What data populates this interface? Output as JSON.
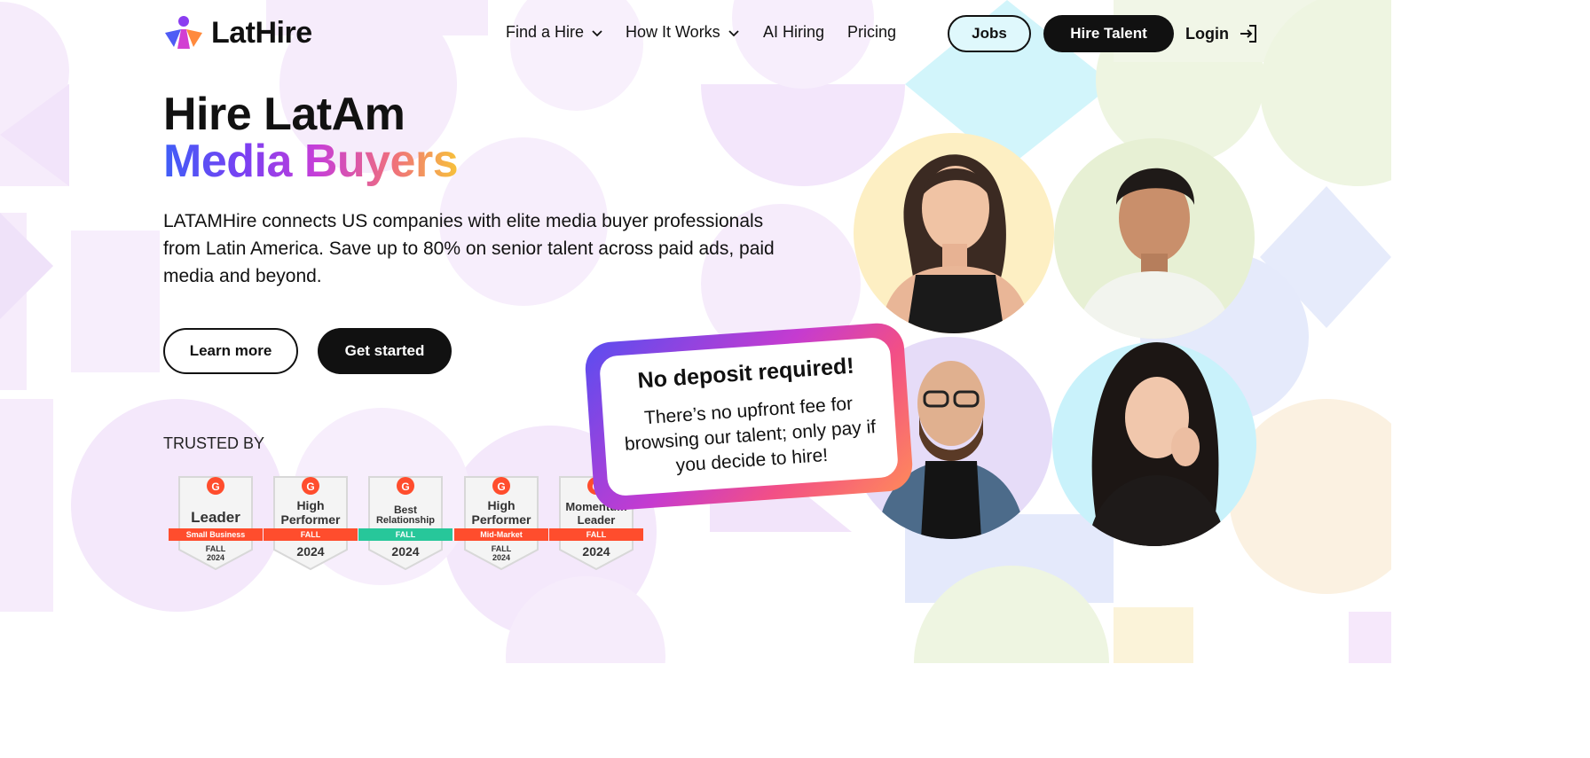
{
  "nav": {
    "logo_text": "LatHire",
    "items": [
      {
        "label": "Find a Hire"
      },
      {
        "label": "How It Works"
      },
      {
        "label": "AI Hiring"
      },
      {
        "label": "Pricing"
      }
    ],
    "jobs_label": "Jobs",
    "hire_label": "Hire Talent",
    "login_label": "Login"
  },
  "hero": {
    "title_line1": "Hire LatAm",
    "title_line2": "Media Buyers",
    "description": "LATAMHire connects US companies with elite media buyer professionals from Latin America. Save up to 80% on senior talent across paid ads, paid media and beyond.",
    "learn_more_label": "Learn more",
    "get_started_label": "Get started",
    "trusted_label": "TRUSTED BY"
  },
  "badges": [
    {
      "title1": "Leader",
      "title2": "",
      "ribbon": "Small Business",
      "ribbon_color": "#ff4d2d",
      "year": "FALL 2024"
    },
    {
      "title1": "High",
      "title2": "Performer",
      "ribbon": "FALL",
      "ribbon_color": "#ff4d2d",
      "year": "2024"
    },
    {
      "title1": "Best",
      "title2": "Relationship",
      "ribbon": "FALL",
      "ribbon_color": "#27c79a",
      "year": "2024"
    },
    {
      "title1": "High",
      "title2": "Performer",
      "ribbon": "Mid-Market",
      "ribbon_color": "#ff4d2d",
      "year": "FALL 2024"
    },
    {
      "title1": "Momentum",
      "title2": "Leader",
      "ribbon": "FALL",
      "ribbon_color": "#ff4d2d",
      "year": "2024"
    }
  ],
  "promo": {
    "title": "No deposit required!",
    "text": "There’s no upfront fee for browsing our talent; only pay if you decide to hire!"
  },
  "colors": {
    "brand_dark": "#111111",
    "jobs_bg": "#dff8fc",
    "gradient_start": "#3f5ef7",
    "gradient_end": "#f7c13a"
  }
}
